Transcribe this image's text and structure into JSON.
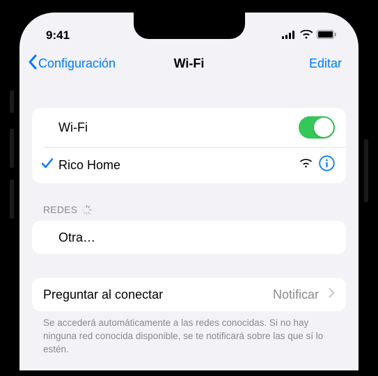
{
  "statusBar": {
    "time": "9:41"
  },
  "nav": {
    "back": "Configuración",
    "title": "Wi-Fi",
    "edit": "Editar"
  },
  "wifi": {
    "label": "Wi-Fi",
    "enabled": true,
    "currentNetwork": "Rico Home"
  },
  "networks": {
    "header": "REDES",
    "other": "Otra…"
  },
  "askToJoin": {
    "label": "Preguntar al conectar",
    "value": "Notificar",
    "footer": "Se accederá automáticamente a las redes conocidas. Si no hay ninguna red conocida disponible, se te notificará sobre las que sí lo estén."
  },
  "colors": {
    "tint": "#007aff",
    "toggleOn": "#34c759",
    "background": "#f2f2f7"
  }
}
